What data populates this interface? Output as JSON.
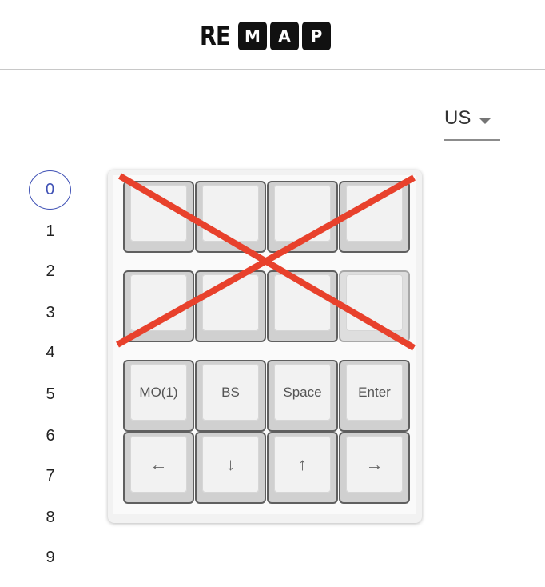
{
  "header": {
    "logo_plain": "RE",
    "logo_boxes": [
      "M",
      "A",
      "P"
    ]
  },
  "layout_select": {
    "value": "US"
  },
  "layers": [
    "0",
    "1",
    "2",
    "3",
    "4",
    "5",
    "6",
    "7",
    "8",
    "9"
  ],
  "active_layer": "0",
  "keyboard": {
    "rows": [
      [
        "",
        "",
        "",
        ""
      ],
      [
        "",
        "",
        "",
        ""
      ],
      [
        "MO(1)",
        "BS",
        "Space",
        "Enter"
      ],
      [
        "←",
        "↓",
        "↑",
        "→"
      ]
    ]
  },
  "colors": {
    "accent": "#3f51b5",
    "cross": "#e8412c",
    "key_border": "#5f5f5f",
    "keycap": "#f2f2f2"
  }
}
